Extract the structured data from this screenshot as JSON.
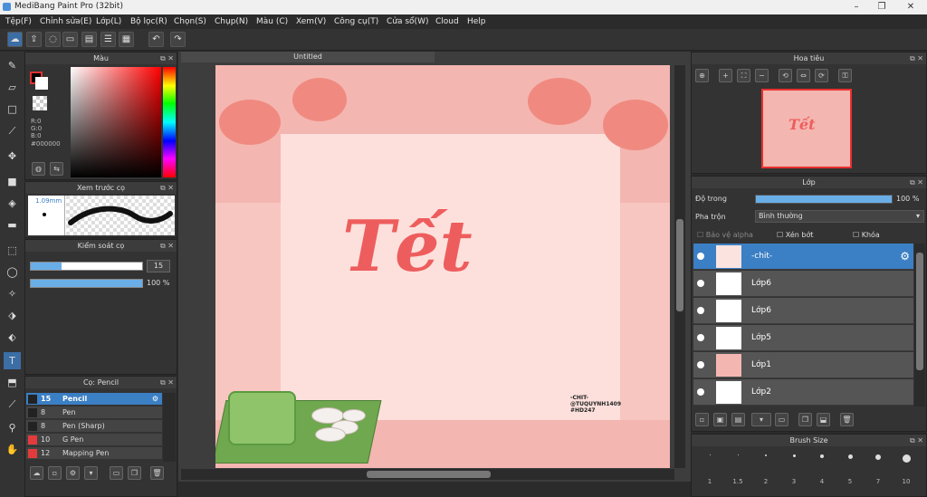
{
  "app": {
    "title": "MediBang Paint Pro (32bit)"
  },
  "menu": [
    "Tệp(F)",
    "Chỉnh sửa(E)",
    "Lớp(L)",
    "Bộ lọc(R)",
    "Chọn(S)",
    "Chụp(N)",
    "Màu (C)",
    "Xem(V)",
    "Công cụ(T)",
    "Cửa sổ(W)",
    "Cloud",
    "Help"
  ],
  "color_panel": {
    "title": "Màu",
    "r": "R:0",
    "g": "G:0",
    "b": "B:0",
    "hex": "#000000",
    "foreground": "#000000",
    "background": "#ffffff"
  },
  "brush_preview": {
    "title": "Xem trước cọ",
    "size": "1.09mm"
  },
  "brush_control": {
    "title": "Kiểm soát cọ",
    "size_value": "15",
    "opacity_value": "100 %",
    "size_fraction": 0.28,
    "opacity_fraction": 1.0
  },
  "brush_list": {
    "title": "Cọ: Pencil",
    "items": [
      {
        "size": "15",
        "name": "Pencil",
        "selected": true,
        "color": "#222222"
      },
      {
        "size": "8",
        "name": "Pen",
        "selected": false,
        "color": "#222222"
      },
      {
        "size": "8",
        "name": "Pen (Sharp)",
        "selected": false,
        "color": "#222222"
      },
      {
        "size": "10",
        "name": "G Pen",
        "selected": false,
        "color": "#e33b3b"
      },
      {
        "size": "12",
        "name": "Mapping Pen",
        "selected": false,
        "color": "#e33b3b"
      }
    ]
  },
  "document": {
    "tab": "Untitled"
  },
  "artwork": {
    "text": "Tết",
    "credit_lines": [
      "-CHIT-",
      "@TUQUYNH1409",
      "#HD247"
    ]
  },
  "navigator": {
    "title": "Hoa tiêu"
  },
  "layers": {
    "title": "Lớp",
    "opacity_label": "Độ trong",
    "opacity_value": "100 %",
    "opacity_fraction": 1.0,
    "blend_label": "Pha trộn",
    "blend_value": "Bình thường",
    "protect_alpha": "Bảo vệ alpha",
    "clipping": "Xén bớt",
    "lock": "Khóa",
    "items": [
      {
        "name": "-chit-",
        "selected": true
      },
      {
        "name": "Lớp6",
        "selected": false
      },
      {
        "name": "Lớp6",
        "selected": false
      },
      {
        "name": "Lớp5",
        "selected": false
      },
      {
        "name": "Lớp1",
        "selected": false
      },
      {
        "name": "Lớp2",
        "selected": false
      }
    ]
  },
  "brush_size": {
    "title": "Brush Size",
    "sizes": [
      "1",
      "1.5",
      "2",
      "3",
      "4",
      "5",
      "7",
      "10"
    ]
  }
}
